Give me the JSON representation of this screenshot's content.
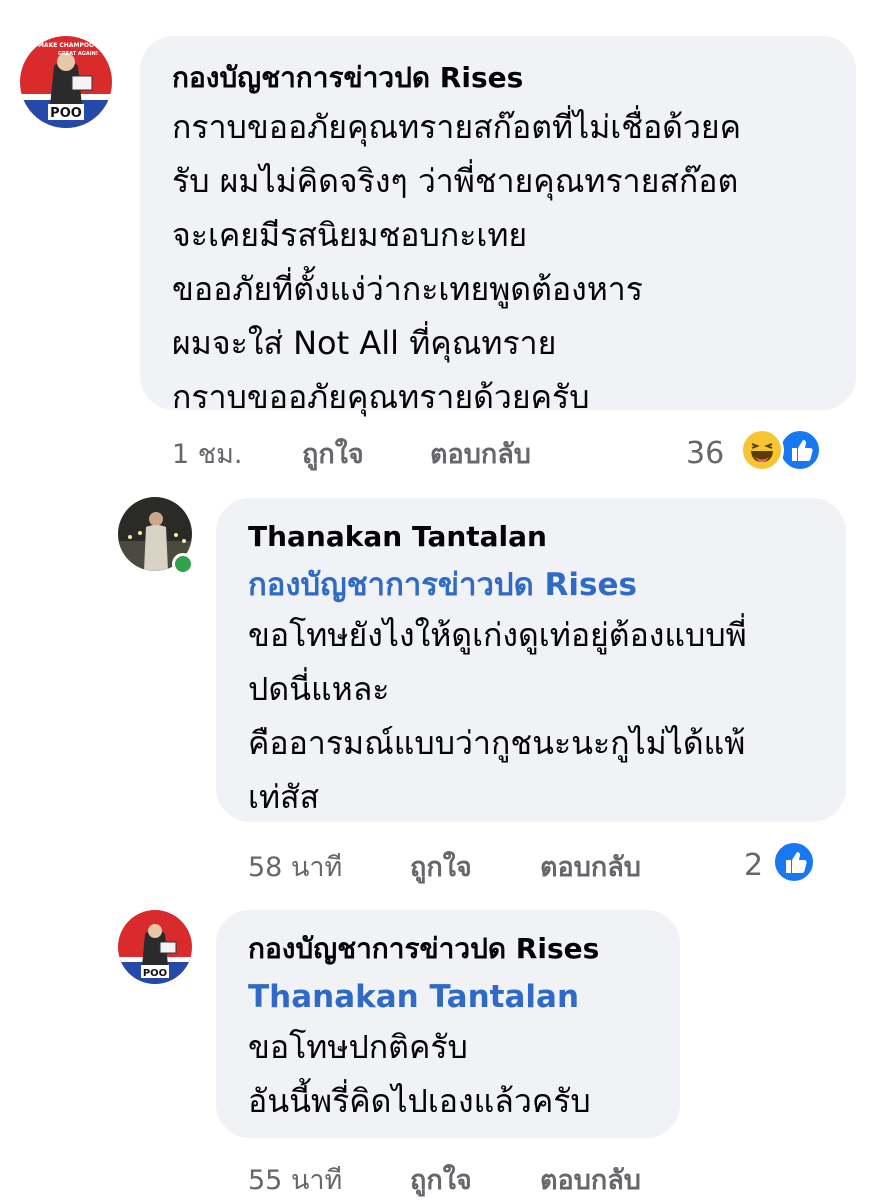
{
  "comments": [
    {
      "author": "กองบัญชาการข่าวปด Rises",
      "avatar_text": {
        "top": "MAKE CHAMPOO",
        "mid": "GREAT AGAIN!",
        "logo": "POO"
      },
      "lines": [
        "กราบขออภัยคุณทรายสก๊อตที่ไม่เชื่อด้วยค",
        "รับ ผมไม่คิดจริงๆ ว่าพี่ชายคุณทรายสก๊อต",
        "จะเคยมีรสนิยมชอบกะเทย",
        "ขออภัยที่ตั้งแง่ว่ากะเทยพูดต้องหาร",
        "ผมจะใส่ Not All ที่คุณทราย",
        "กราบขออภัยคุณทรายด้วยครับ"
      ],
      "time": "1 ชม.",
      "like": "ถูกใจ",
      "reply": "ตอบกลับ",
      "reaction_count": "36"
    },
    {
      "author": "Thanakan Tantalan",
      "mention": "กองบัญชาการข่าวปด Rises",
      "lines": [
        "ขอโทษยังไงให้ดูเก่งดูเท่อยู่ต้องแบบพี่",
        "ปดนี่แหละ",
        "คืออารมณ์แบบว่ากูชนะนะกูไม่ได้แพ้",
        "เท่สัส"
      ],
      "time": "58 นาที",
      "like": "ถูกใจ",
      "reply": "ตอบกลับ",
      "reaction_count": "2"
    },
    {
      "author": "กองบัญชาการข่าวปด Rises",
      "mention": "Thanakan Tantalan",
      "lines": [
        "ขอโทษปกติครับ",
        "อันนี้พรี่คิดไปเองแล้วครับ"
      ],
      "time": "55 นาที",
      "like": "ถูกใจ",
      "reply": "ตอบกลับ"
    }
  ],
  "colors": {
    "bubble": "#f0f2f5",
    "mention": "#2f6bc6",
    "meta": "#65676b",
    "like_blue": "#1877f2",
    "online": "#31a24c"
  }
}
